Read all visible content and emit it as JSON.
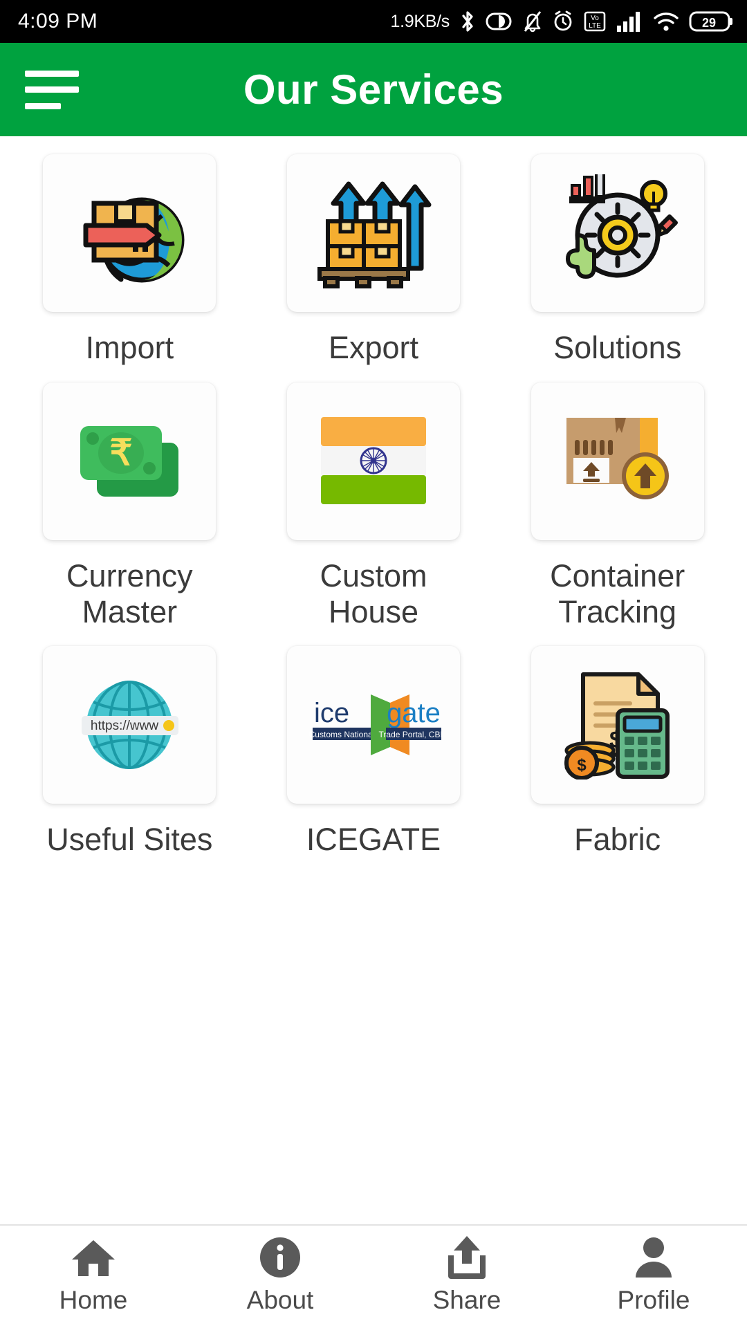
{
  "status_bar": {
    "time": "4:09 PM",
    "network_speed": "1.9KB/s",
    "icons": [
      "bluetooth-icon",
      "battery-saver-icon",
      "mute-icon",
      "alarm-icon",
      "volte-icon",
      "signal-icon",
      "wifi-icon"
    ],
    "battery_level": "29"
  },
  "app_bar": {
    "title": "Our Services",
    "menu_icon": "hamburger-menu-icon",
    "background_color": "#00a23f"
  },
  "services": [
    {
      "label": "Import",
      "icon": "globe-package-icon"
    },
    {
      "label": "Export",
      "icon": "pallet-arrows-icon"
    },
    {
      "label": "Solutions",
      "icon": "gear-chart-bulb-icon"
    },
    {
      "label": "Currency\nMaster",
      "icon": "rupee-banknotes-icon"
    },
    {
      "label": "Custom\nHouse",
      "icon": "india-flag-icon"
    },
    {
      "label": "Container\nTracking",
      "icon": "parcel-arrow-icon"
    },
    {
      "label": "Useful Sites",
      "icon": "globe-url-icon"
    },
    {
      "label": "ICEGATE",
      "icon": "icegate-logo-icon"
    },
    {
      "label": "Fabric",
      "icon": "invoice-calculator-icon"
    }
  ],
  "icegate_logo": {
    "text_left": "ice",
    "text_right": "gate",
    "subtitle_left": "Customs National",
    "subtitle_right": "Trade Portal, CBIC"
  },
  "useful_sites_icon": {
    "url_text": "https://www"
  },
  "bottom_nav": [
    {
      "label": "Home",
      "icon": "home-icon"
    },
    {
      "label": "About",
      "icon": "info-icon"
    },
    {
      "label": "Share",
      "icon": "share-icon"
    },
    {
      "label": "Profile",
      "icon": "person-icon"
    }
  ]
}
